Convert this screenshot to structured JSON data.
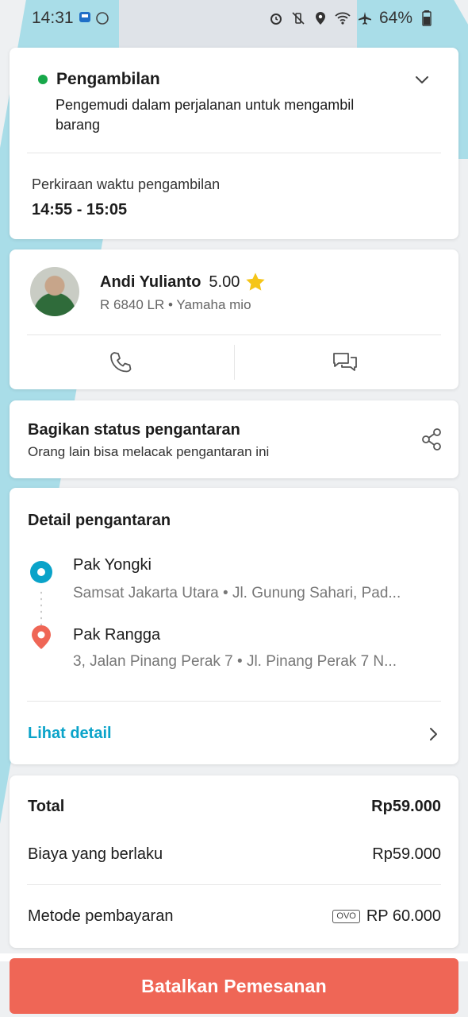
{
  "status_bar": {
    "time": "14:31",
    "battery": "64%"
  },
  "pickup": {
    "title": "Pengambilan",
    "description": "Pengemudi dalam perjalanan untuk mengambil barang",
    "eta_label": "Perkiraan waktu pengambilan",
    "eta_value": "14:55 - 15:05",
    "status_color": "#17a84a"
  },
  "driver": {
    "name": "Andi Yulianto",
    "rating": "5.00",
    "vehicle": "R 6840 LR • Yamaha mio"
  },
  "share": {
    "title": "Bagikan status pengantaran",
    "subtitle": "Orang lain bisa melacak pengantaran ini"
  },
  "delivery": {
    "title": "Detail pengantaran",
    "origin_name": "Pak Yongki",
    "origin_address": "Samsat Jakarta Utara • Jl. Gunung Sahari, Pad...",
    "destination_name": "Pak Rangga",
    "destination_address": "3, Jalan Pinang Perak 7 • Jl. Pinang Perak 7 N...",
    "detail_link": "Lihat detail",
    "accent_color": "#0aa3c9"
  },
  "payment": {
    "total_label": "Total",
    "total_value": "Rp59.000",
    "fee_label": "Biaya yang berlaku",
    "fee_value": "Rp59.000",
    "method_label": "Metode pembayaran",
    "method_badge": "OVO",
    "method_value": "RP 60.000"
  },
  "cancel_button": {
    "label": "Batalkan Pemesanan",
    "color": "#ef6656"
  }
}
